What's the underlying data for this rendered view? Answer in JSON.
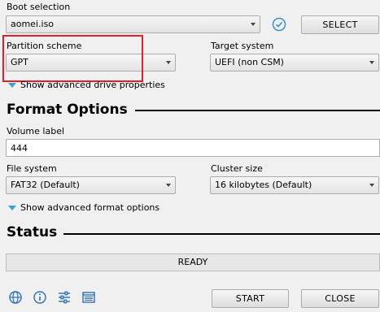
{
  "boot_selection": {
    "label": "Boot selection",
    "value": "aomei.iso",
    "select_button": "SELECT"
  },
  "partition_scheme": {
    "label": "Partition scheme",
    "value": "GPT"
  },
  "target_system": {
    "label": "Target system",
    "value": "UEFI (non CSM)"
  },
  "show_advanced_drive": "Show advanced drive properties",
  "format_options": {
    "title": "Format Options",
    "volume_label": {
      "label": "Volume label",
      "value": "444"
    },
    "file_system": {
      "label": "File system",
      "value": "FAT32 (Default)"
    },
    "cluster_size": {
      "label": "Cluster size",
      "value": "16 kilobytes (Default)"
    },
    "show_advanced_format": "Show advanced format options"
  },
  "status": {
    "title": "Status",
    "text": "READY"
  },
  "buttons": {
    "start": "START",
    "close": "CLOSE"
  },
  "icons": [
    "globe-icon",
    "info-icon",
    "settings-sliders-icon",
    "log-icon",
    "checkmark-icon"
  ],
  "colors": {
    "highlight_box": "#e0202a",
    "accent": "#3aa0d8"
  }
}
